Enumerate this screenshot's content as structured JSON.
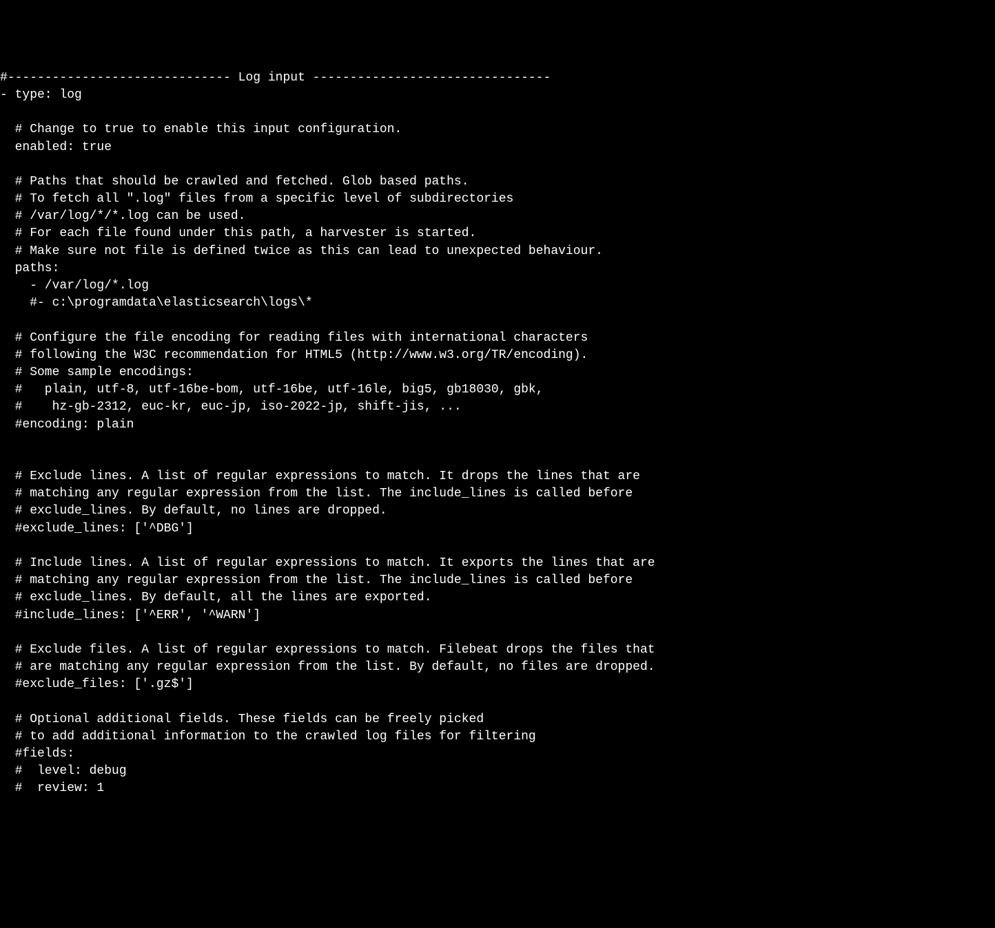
{
  "lines": [
    "#------------------------------ Log input --------------------------------",
    "- type: log",
    "",
    "  # Change to true to enable this input configuration.",
    "  enabled: true",
    "",
    "  # Paths that should be crawled and fetched. Glob based paths.",
    "  # To fetch all \".log\" files from a specific level of subdirectories",
    "  # /var/log/*/*.log can be used.",
    "  # For each file found under this path, a harvester is started.",
    "  # Make sure not file is defined twice as this can lead to unexpected behaviour.",
    "  paths:",
    "    - /var/log/*.log",
    "    #- c:\\programdata\\elasticsearch\\logs\\*",
    "",
    "  # Configure the file encoding for reading files with international characters",
    "  # following the W3C recommendation for HTML5 (http://www.w3.org/TR/encoding).",
    "  # Some sample encodings:",
    "  #   plain, utf-8, utf-16be-bom, utf-16be, utf-16le, big5, gb18030, gbk,",
    "  #    hz-gb-2312, euc-kr, euc-jp, iso-2022-jp, shift-jis, ...",
    "  #encoding: plain",
    "",
    "",
    "  # Exclude lines. A list of regular expressions to match. It drops the lines that are",
    "  # matching any regular expression from the list. The include_lines is called before",
    "  # exclude_lines. By default, no lines are dropped.",
    "  #exclude_lines: ['^DBG']",
    "",
    "  # Include lines. A list of regular expressions to match. It exports the lines that are",
    "  # matching any regular expression from the list. The include_lines is called before",
    "  # exclude_lines. By default, all the lines are exported.",
    "  #include_lines: ['^ERR', '^WARN']",
    "",
    "  # Exclude files. A list of regular expressions to match. Filebeat drops the files that",
    "  # are matching any regular expression from the list. By default, no files are dropped.",
    "  #exclude_files: ['.gz$']",
    "",
    "  # Optional additional fields. These fields can be freely picked",
    "  # to add additional information to the crawled log files for filtering",
    "  #fields:",
    "  #  level: debug",
    "  #  review: 1"
  ]
}
